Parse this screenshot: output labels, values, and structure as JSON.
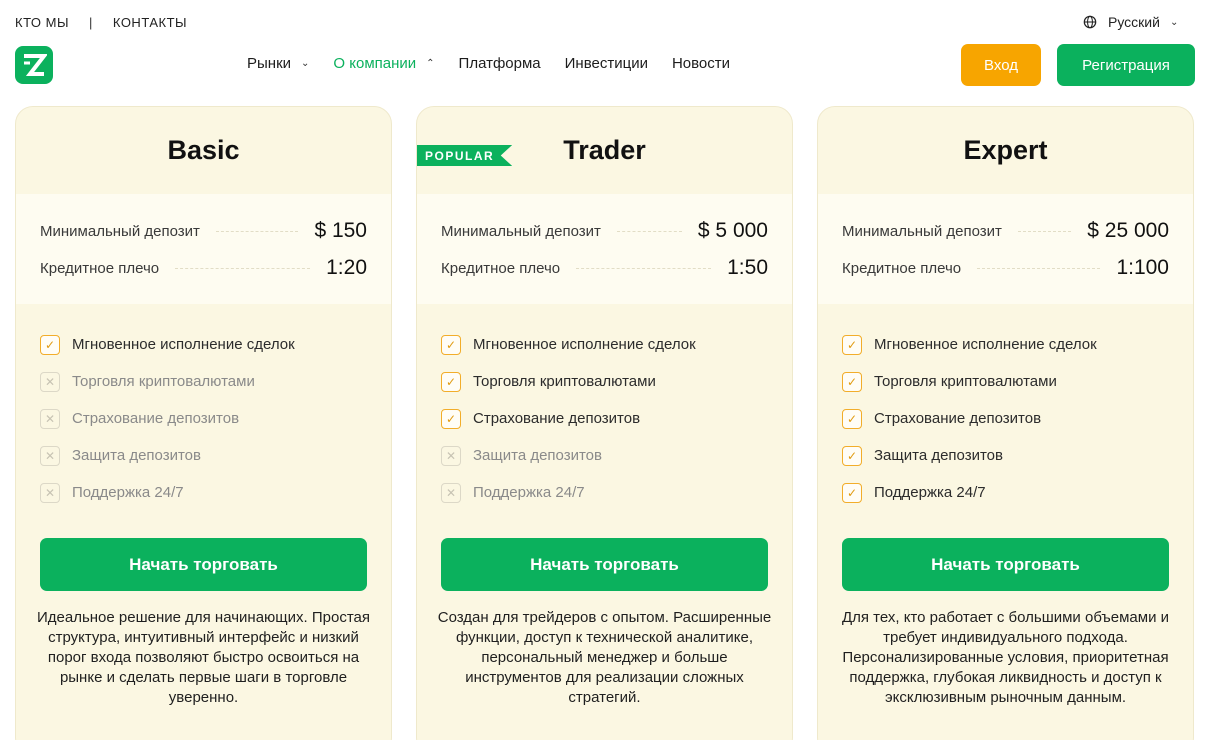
{
  "topbar": {
    "about_label": "КТО МЫ",
    "separator": "|",
    "contacts_label": "КОНТАКТЫ",
    "language": "Русский"
  },
  "nav": {
    "items": [
      {
        "label": "Рынки",
        "has_caret": true,
        "caret": "⌄",
        "active": false
      },
      {
        "label": "О компании",
        "has_caret": true,
        "caret": "⌃",
        "active": true
      },
      {
        "label": "Платформа",
        "has_caret": false,
        "active": false
      },
      {
        "label": "Инвестиции",
        "has_caret": false,
        "active": false
      },
      {
        "label": "Новости",
        "has_caret": false,
        "active": false
      }
    ],
    "login_label": "Вход",
    "register_label": "Регистрация"
  },
  "colors": {
    "brand_green": "#0bb15d",
    "accent_orange": "#f7a500",
    "card_bg": "#fbf7e2"
  },
  "plans": [
    {
      "name": "Basic",
      "badge": "",
      "min_deposit_label": "Минимальный депозит",
      "min_deposit_value": "$ 150",
      "leverage_label": "Кредитное плечо",
      "leverage_value": "1:20",
      "features": [
        {
          "label": "Мгновенное исполнение сделок",
          "included": true
        },
        {
          "label": "Торговля криптовалютами",
          "included": false
        },
        {
          "label": "Страхование депозитов",
          "included": false
        },
        {
          "label": "Защита депозитов",
          "included": false
        },
        {
          "label": "Поддержка 24/7",
          "included": false
        }
      ],
      "cta_label": "Начать торговать",
      "description": "Идеальное решение для начинающих. Простая структура, интуитивный интерфейс и низкий порог входа позволяют быстро освоиться на рынке и сделать первые шаги в торговле уверенно."
    },
    {
      "name": "Trader",
      "badge": "POPULAR",
      "min_deposit_label": "Минимальный депозит",
      "min_deposit_value": "$ 5 000",
      "leverage_label": "Кредитное плечо",
      "leverage_value": "1:50",
      "features": [
        {
          "label": "Мгновенное исполнение сделок",
          "included": true
        },
        {
          "label": "Торговля криптовалютами",
          "included": true
        },
        {
          "label": "Страхование депозитов",
          "included": true
        },
        {
          "label": "Защита депозитов",
          "included": false
        },
        {
          "label": "Поддержка 24/7",
          "included": false
        }
      ],
      "cta_label": "Начать торговать",
      "description": "Создан для трейдеров с опытом. Расширенные функции, доступ к технической аналитике, персональный менеджер и больше инструментов для реализации сложных стратегий."
    },
    {
      "name": "Expert",
      "badge": "",
      "min_deposit_label": "Минимальный депозит",
      "min_deposit_value": "$ 25 000",
      "leverage_label": "Кредитное плечо",
      "leverage_value": "1:100",
      "features": [
        {
          "label": "Мгновенное исполнение сделок",
          "included": true
        },
        {
          "label": "Торговля криптовалютами",
          "included": true
        },
        {
          "label": "Страхование депозитов",
          "included": true
        },
        {
          "label": "Защита депозитов",
          "included": true
        },
        {
          "label": "Поддержка 24/7",
          "included": true
        }
      ],
      "cta_label": "Начать торговать",
      "description": "Для тех, кто работает с большими объемами и требует индивидуального подхода. Персонализированные условия, приоритетная поддержка, глубокая ликвидность и доступ к эксклюзивным рыночным данным."
    }
  ]
}
